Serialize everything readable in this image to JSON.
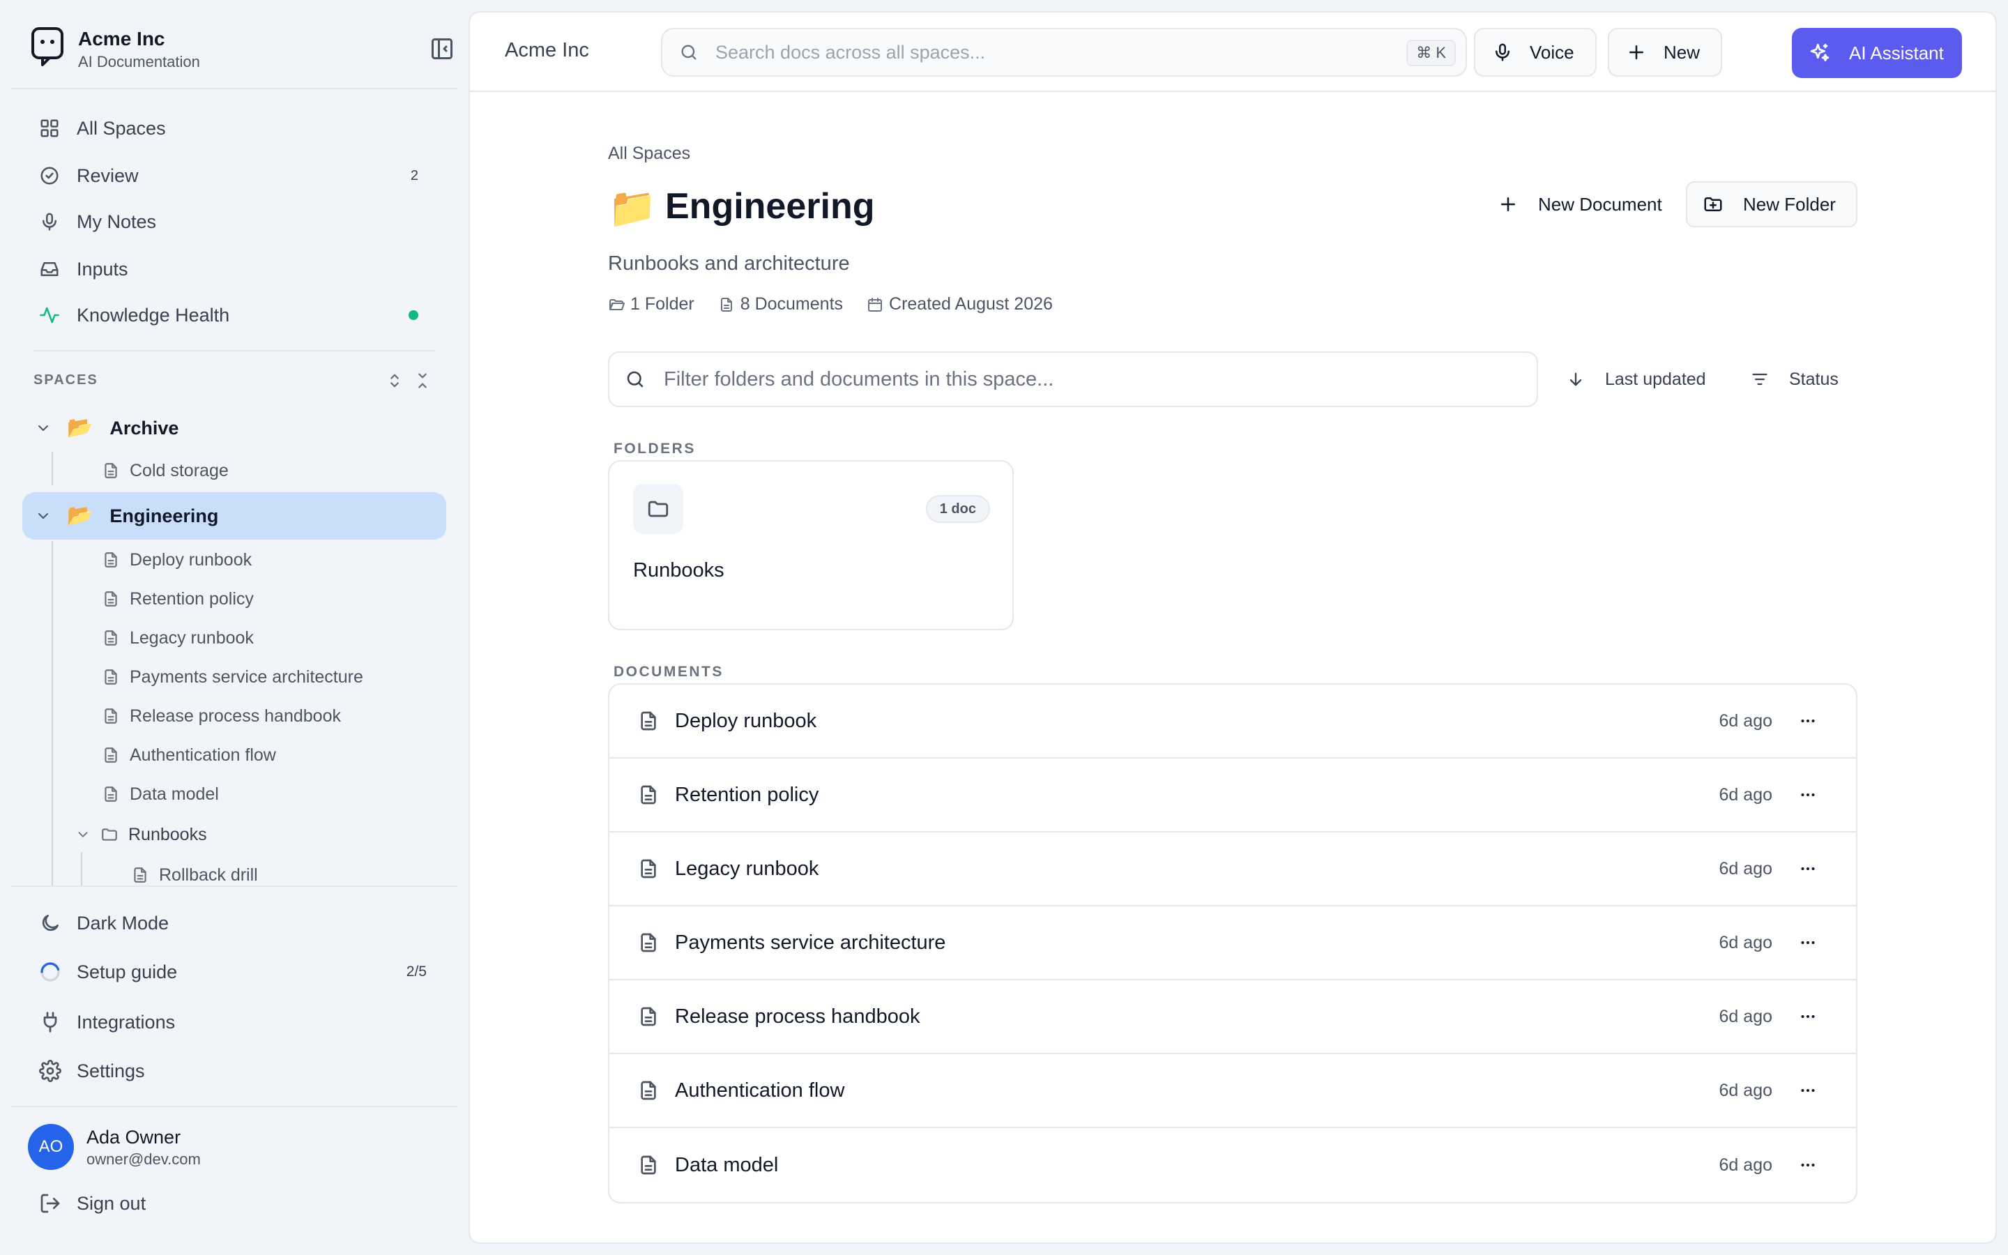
{
  "sidebar": {
    "org_name": "Acme Inc",
    "org_sub": "AI Documentation",
    "nav": [
      {
        "label": "All Spaces",
        "icon": "grid-icon"
      },
      {
        "label": "Review",
        "icon": "check-circle-icon",
        "count": "2"
      },
      {
        "label": "My Notes",
        "icon": "microphone-icon"
      },
      {
        "label": "Inputs",
        "icon": "inbox-icon"
      },
      {
        "label": "Knowledge Health",
        "icon": "activity-icon",
        "status_color": "#10b981"
      }
    ],
    "spaces_label": "SPACES",
    "spaces": [
      {
        "name": "Archive",
        "emoji": "📂",
        "docs": [
          "Cold storage"
        ]
      },
      {
        "name": "Engineering",
        "emoji": "📂",
        "docs": [
          "Deploy runbook",
          "Retention policy",
          "Legacy runbook",
          "Payments service architecture",
          "Release process handbook",
          "Authentication flow",
          "Data model"
        ],
        "folder": {
          "name": "Runbooks",
          "docs": [
            "Rollback drill"
          ]
        }
      }
    ],
    "bottom": [
      {
        "label": "Dark Mode",
        "icon": "moon-icon"
      },
      {
        "label": "Setup guide",
        "icon": "progress-ring-icon",
        "count": "2/5"
      },
      {
        "label": "Integrations",
        "icon": "plug-icon"
      },
      {
        "label": "Settings",
        "icon": "gear-icon"
      }
    ],
    "user": {
      "initials": "AO",
      "name": "Ada Owner",
      "email": "owner@dev.com"
    },
    "sign_out": "Sign out"
  },
  "topbar": {
    "title": "Acme Inc",
    "search_placeholder": "Search docs across all spaces...",
    "shortcut": "⌘ K",
    "voice_label": "Voice",
    "new_label": "New",
    "ai_label": "AI Assistant",
    "accent": "#5b5bf0"
  },
  "page": {
    "breadcrumb": "All Spaces",
    "emoji": "📁",
    "title": "Engineering",
    "description": "Runbooks and architecture",
    "meta": {
      "folders": "1 Folder",
      "documents": "8 Documents",
      "created": "Created August 2026"
    },
    "new_document_label": "New Document",
    "new_folder_label": "New Folder",
    "filter_placeholder": "Filter folders and documents in this space...",
    "sort_label": "Last updated",
    "status_label": "Status",
    "folders_label": "FOLDERS",
    "folders": [
      {
        "name": "Runbooks",
        "badge": "1 doc"
      }
    ],
    "documents_label": "DOCUMENTS",
    "documents": [
      {
        "title": "Deploy runbook",
        "updated": "6d ago"
      },
      {
        "title": "Retention policy",
        "updated": "6d ago"
      },
      {
        "title": "Legacy runbook",
        "updated": "6d ago"
      },
      {
        "title": "Payments service architecture",
        "updated": "6d ago"
      },
      {
        "title": "Release process handbook",
        "updated": "6d ago"
      },
      {
        "title": "Authentication flow",
        "updated": "6d ago"
      },
      {
        "title": "Data model",
        "updated": "6d ago"
      }
    ]
  }
}
